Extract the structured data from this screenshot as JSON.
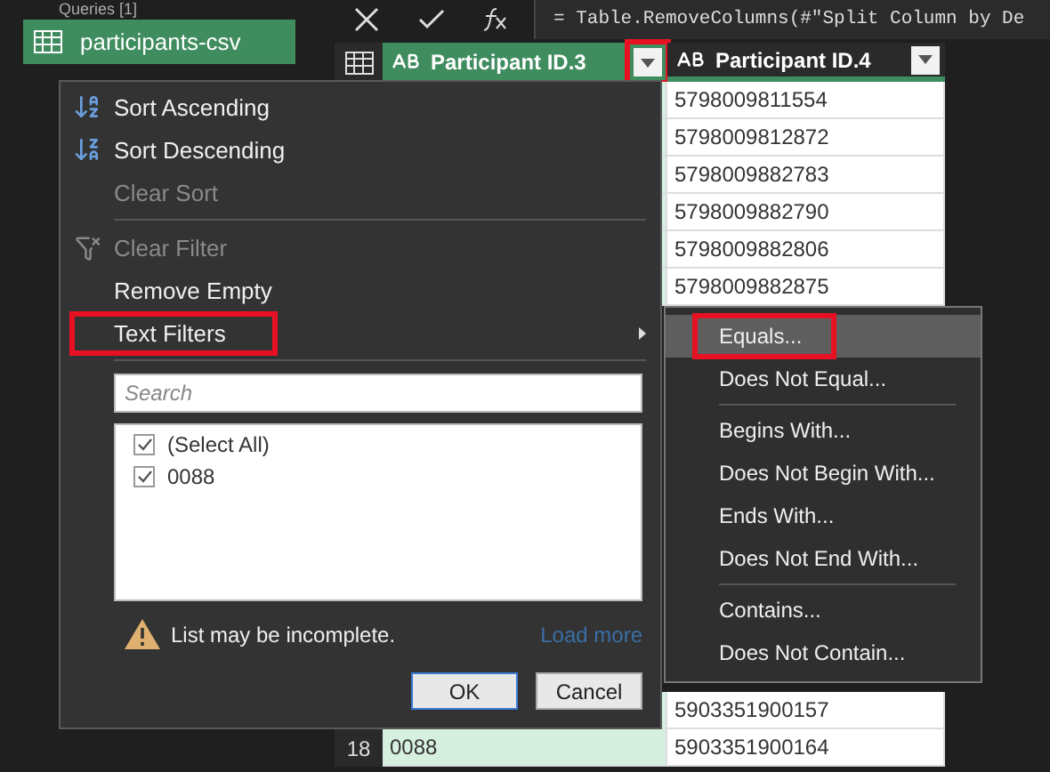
{
  "queries_panel": {
    "title": "Queries [1]",
    "items": [
      {
        "label": "participants-csv",
        "selected": true
      }
    ]
  },
  "formula_bar": {
    "formula": "= Table.RemoveColumns(#\"Split Column by De"
  },
  "table": {
    "columns": [
      {
        "label": "Participant ID.3",
        "selected": true,
        "annotated": true
      },
      {
        "label": "Participant ID.4",
        "selected": false,
        "annotated": false
      }
    ],
    "rows_top": [
      {
        "participant_id_4": "5798009811554"
      },
      {
        "participant_id_4": "5798009812872"
      },
      {
        "participant_id_4": "5798009882783"
      },
      {
        "participant_id_4": "5798009882790"
      },
      {
        "participant_id_4": "5798009882806"
      },
      {
        "participant_id_4": "5798009882875"
      }
    ],
    "rows_bottom": [
      {
        "participant_id_4": "5903351900157"
      },
      {
        "row_number": "18",
        "participant_id_3": "0088",
        "participant_id_4": "5903351900164"
      }
    ]
  },
  "filter_menu": {
    "items": [
      {
        "kind": "item",
        "label": "Sort Ascending",
        "disabled": false,
        "annotated": false,
        "submenu": false
      },
      {
        "kind": "item",
        "label": "Sort Descending",
        "disabled": false,
        "annotated": false,
        "submenu": false
      },
      {
        "kind": "item",
        "label": "Clear Sort",
        "disabled": true,
        "annotated": false,
        "submenu": false
      },
      {
        "kind": "separator"
      },
      {
        "kind": "item",
        "label": "Clear Filter",
        "disabled": true,
        "annotated": false,
        "submenu": false
      },
      {
        "kind": "item",
        "label": "Remove Empty",
        "disabled": false,
        "annotated": false,
        "submenu": false
      },
      {
        "kind": "item",
        "label": "Text Filters",
        "disabled": false,
        "annotated": true,
        "submenu": true
      }
    ],
    "search": {
      "placeholder": "Search"
    },
    "values": [
      {
        "label": "(Select All)",
        "checked": true
      },
      {
        "label": "0088",
        "checked": true
      }
    ],
    "warning": "List may be incomplete.",
    "load_more": "Load more",
    "buttons": [
      {
        "label": "OK",
        "default": true
      },
      {
        "label": "Cancel",
        "default": false
      }
    ]
  },
  "text_filters_menu": {
    "items": [
      {
        "kind": "item",
        "label": "Equals...",
        "selected": true,
        "annotated": true
      },
      {
        "kind": "item",
        "label": "Does Not Equal...",
        "selected": false,
        "annotated": false
      },
      {
        "kind": "separator"
      },
      {
        "kind": "item",
        "label": "Begins With...",
        "selected": false,
        "annotated": false
      },
      {
        "kind": "item",
        "label": "Does Not Begin With...",
        "selected": false,
        "annotated": false
      },
      {
        "kind": "item",
        "label": "Ends With...",
        "selected": false,
        "annotated": false
      },
      {
        "kind": "item",
        "label": "Does Not End With...",
        "selected": false,
        "annotated": false
      },
      {
        "kind": "separator"
      },
      {
        "kind": "item",
        "label": "Contains...",
        "selected": false,
        "annotated": false
      },
      {
        "kind": "item",
        "label": "Does Not Contain...",
        "selected": false,
        "annotated": false
      }
    ]
  }
}
